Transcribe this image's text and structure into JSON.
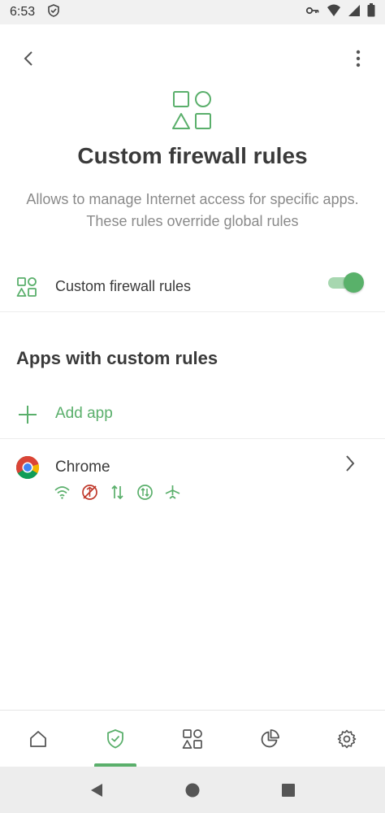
{
  "status_bar": {
    "time": "6:53"
  },
  "header": {
    "title": "Custom firewall rules",
    "description": "Allows to manage Internet access for specific apps. These rules override global rules"
  },
  "toggle": {
    "label": "Custom firewall rules",
    "enabled": true
  },
  "apps_section": {
    "title": "Apps with custom rules",
    "add_label": "Add app",
    "apps": [
      {
        "name": "Chrome",
        "rule_icons": [
          "wifi-icon",
          "mobile-data-blocked-icon",
          "data-transfer-icon",
          "background-data-icon",
          "airplane-icon"
        ]
      }
    ]
  },
  "colors": {
    "accent": "#5aaf6b",
    "blocked": "#c0392b",
    "text": "#3a3a3a",
    "muted": "#8a8a8a"
  },
  "bottom_nav": {
    "items": [
      "home-icon",
      "protection-icon",
      "apps-icon",
      "stats-icon",
      "settings-icon"
    ],
    "active_index": 1
  }
}
